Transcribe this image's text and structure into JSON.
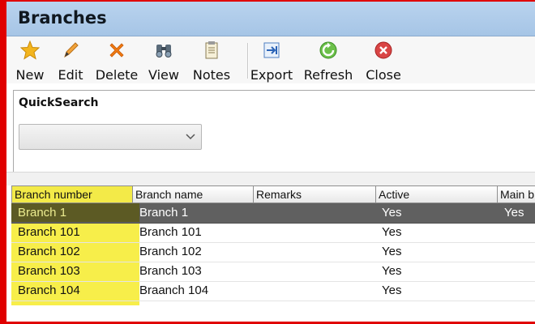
{
  "window": {
    "title": "Branches"
  },
  "toolbar": {
    "new": "New",
    "edit": "Edit",
    "delete": "Delete",
    "view": "View",
    "notes": "Notes",
    "export": "Export",
    "refresh": "Refresh",
    "close": "Close"
  },
  "quicksearch": {
    "title": "QuickSearch",
    "selected": ""
  },
  "grid": {
    "columns": [
      "Branch number",
      "Branch name",
      "Remarks",
      "Active",
      "Main b"
    ],
    "rows": [
      [
        "Branch 1",
        "Branch 1",
        "",
        "Yes",
        "Yes"
      ],
      [
        "Branch 101",
        "Branch 101",
        "",
        "Yes",
        ""
      ],
      [
        "Branch 102",
        "Branch 102",
        "",
        "Yes",
        ""
      ],
      [
        "Branch 103",
        "Branch 103",
        "",
        "Yes",
        ""
      ],
      [
        "Branch 104",
        "Braanch 104",
        "",
        "Yes",
        ""
      ]
    ]
  },
  "colors": {
    "accent_frame": "#e00000",
    "highlight": "#f7ee4a",
    "selected_row": "#606060",
    "titlebar": "#b9d3ee"
  },
  "icons": [
    "star-icon",
    "pencil-icon",
    "cross-icon",
    "binoculars-icon",
    "notepad-icon",
    "export-icon",
    "refresh-icon",
    "close-circle-icon",
    "chevron-down-icon"
  ]
}
